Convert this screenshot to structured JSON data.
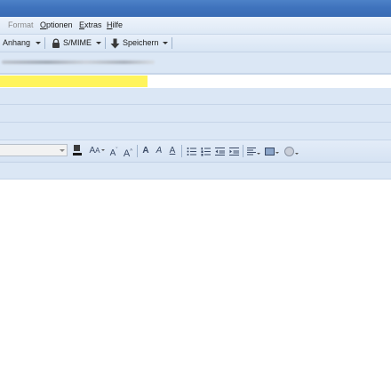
{
  "menu": {
    "format": "Format",
    "options": "Optionen",
    "extras": "Extras",
    "help": "Hilfe"
  },
  "toolbar": {
    "attach_label": "Anhang",
    "smime_label": "S/MIME",
    "save_label": "Speichern"
  },
  "compose": {
    "to_value_highlight": ""
  },
  "colors": {
    "titlebar": "#3f73bd",
    "highlight": "#fff45c",
    "header_bg": "#dbe7f5"
  },
  "icons": {
    "security": "lock-icon",
    "save": "save-arrow-icon",
    "emoji": "smiley-icon"
  }
}
